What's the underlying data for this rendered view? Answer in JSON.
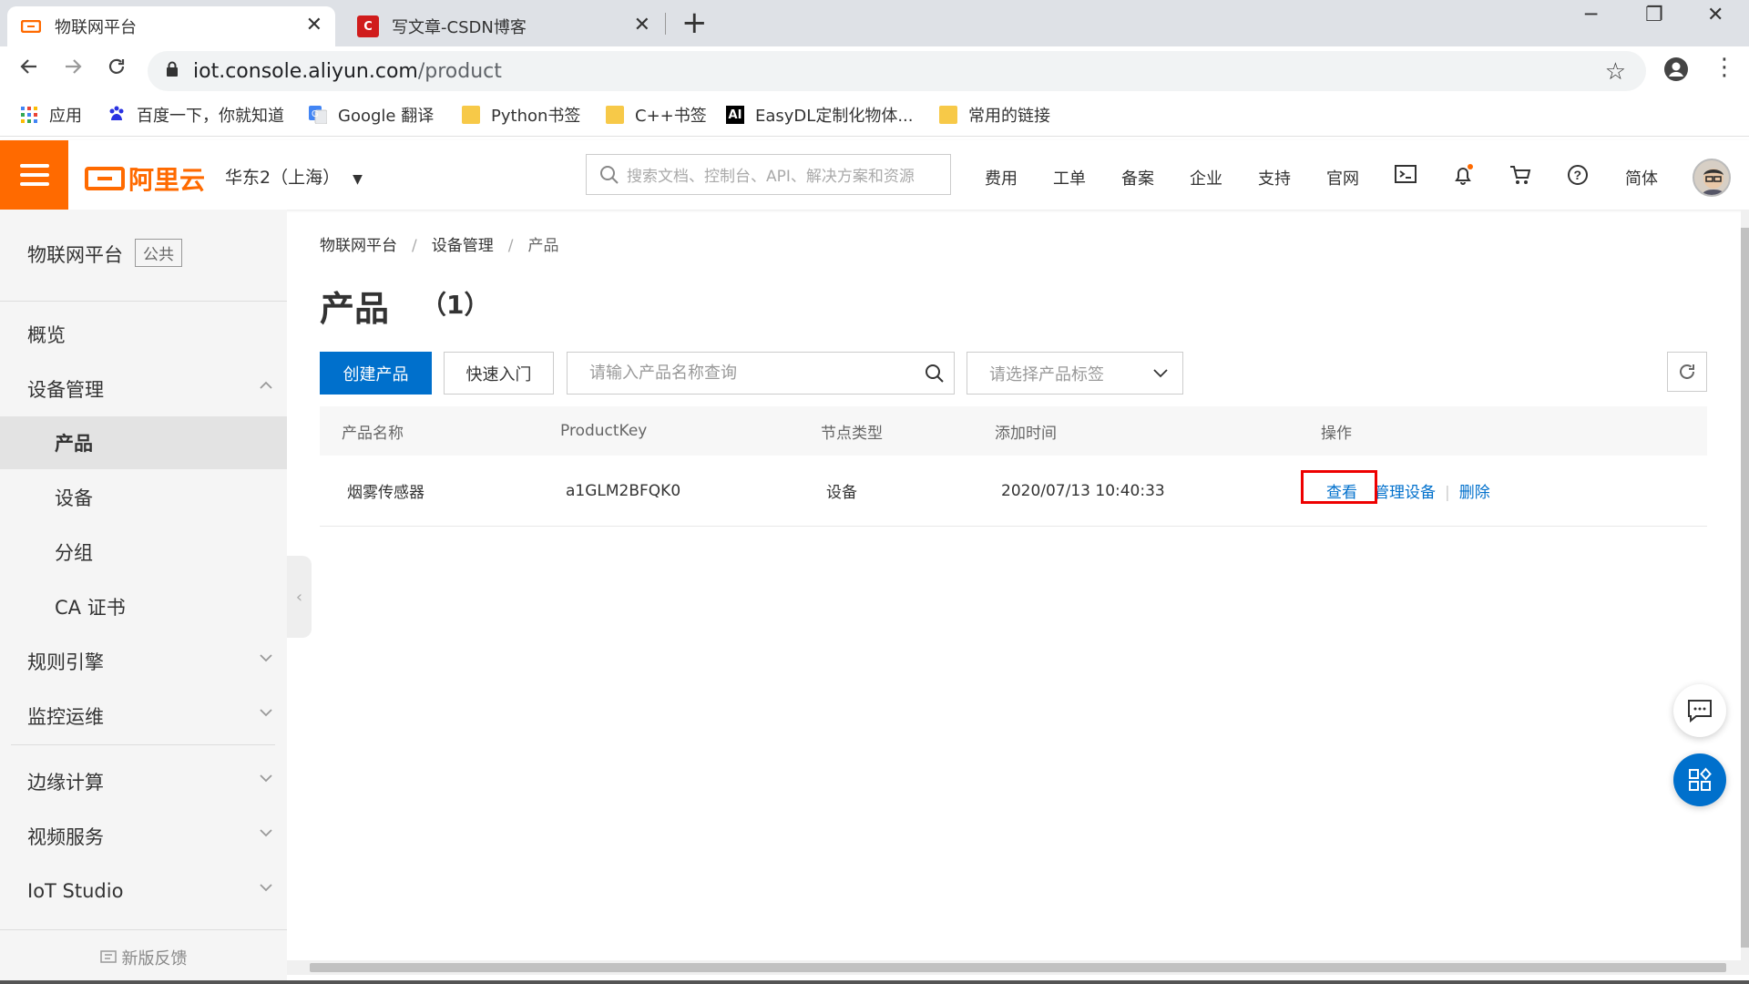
{
  "browser": {
    "tabs": [
      {
        "title": "物联网平台",
        "favicon": "aliyun-icon"
      },
      {
        "title": "写文章-CSDN博客",
        "favicon": "csdn-icon"
      }
    ],
    "url_host": "iot.console.aliyun.com",
    "url_path": "/product",
    "bookmarks": [
      {
        "label": "应用",
        "icon": "apps-grid-icon"
      },
      {
        "label": "百度一下，你就知道",
        "icon": "baidu-icon"
      },
      {
        "label": "Google 翻译",
        "icon": "google-translate-icon"
      },
      {
        "label": "Python书签",
        "icon": "folder-icon"
      },
      {
        "label": "C++书签",
        "icon": "folder-icon"
      },
      {
        "label": "EasyDL定制化物体...",
        "icon": "ai-icon",
        "icon_text": "AI"
      },
      {
        "label": "常用的链接",
        "icon": "folder-icon"
      }
    ]
  },
  "header": {
    "logo_text": "阿里云",
    "region": "华东2（上海）",
    "search_placeholder": "搜索文档、控制台、API、解决方案和资源",
    "links": [
      "费用",
      "工单",
      "备案",
      "企业",
      "支持",
      "官网"
    ],
    "lang": "简体",
    "accent": "#ff6a00"
  },
  "sidebar": {
    "title": "物联网平台",
    "badge": "公共",
    "items": [
      {
        "label": "概览",
        "type": "top"
      },
      {
        "label": "设备管理",
        "type": "top",
        "expanded": true
      },
      {
        "label": "产品",
        "type": "sub",
        "active": true
      },
      {
        "label": "设备",
        "type": "sub"
      },
      {
        "label": "分组",
        "type": "sub"
      },
      {
        "label": "CA 证书",
        "type": "sub"
      },
      {
        "label": "规则引擎",
        "type": "top",
        "expanded": false
      },
      {
        "label": "监控运维",
        "type": "top",
        "expanded": false
      },
      {
        "label": "边缘计算",
        "type": "top",
        "expanded": false
      },
      {
        "label": "视频服务",
        "type": "top",
        "expanded": false
      },
      {
        "label": "IoT Studio",
        "type": "top",
        "expanded": false
      }
    ],
    "feedback": "新版反馈"
  },
  "main": {
    "breadcrumb": [
      "物联网平台",
      "设备管理",
      "产品"
    ],
    "title": "产品",
    "count": "（1）",
    "create_button": "创建产品",
    "quick_start_button": "快速入门",
    "search_placeholder": "请输入产品名称查询",
    "tag_select_placeholder": "请选择产品标签",
    "table": {
      "columns": [
        "产品名称",
        "ProductKey",
        "节点类型",
        "添加时间",
        "操作"
      ],
      "rows": [
        {
          "name": "烟雾传感器",
          "product_key": "a1GLM2BFQK0",
          "node_type": "设备",
          "created": "2020/07/13 10:40:33",
          "actions": [
            "查看",
            "管理设备",
            "删除"
          ]
        }
      ]
    },
    "link_color": "#0070cc",
    "primary_color": "#0070cc"
  }
}
